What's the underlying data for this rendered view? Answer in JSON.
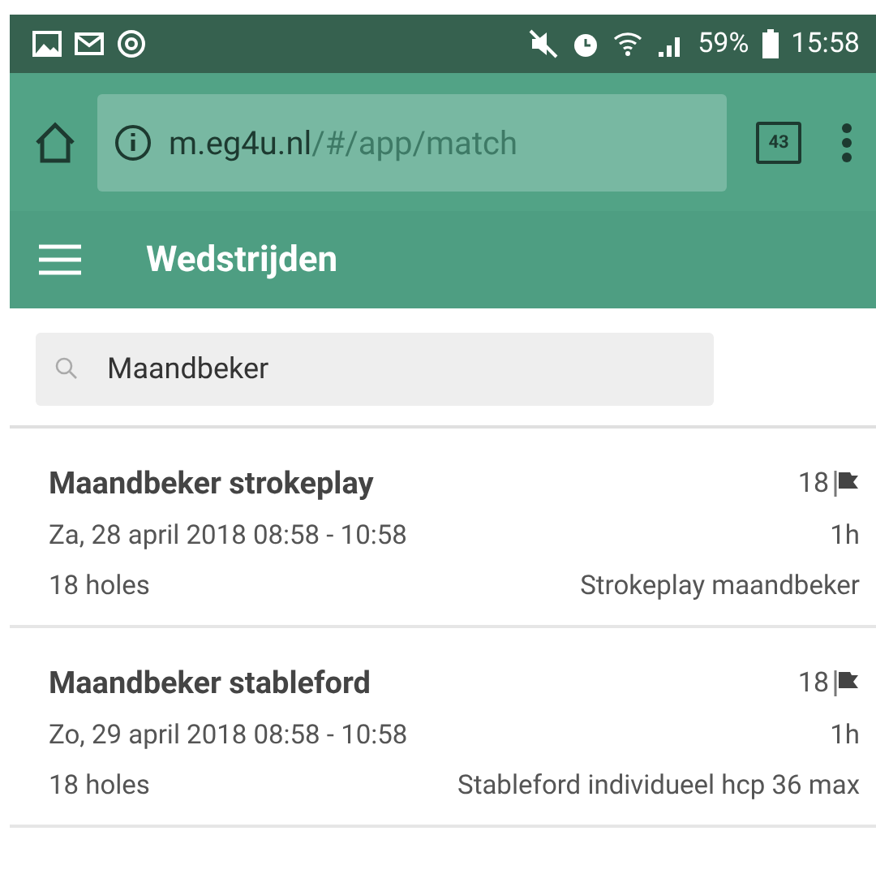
{
  "status_bar": {
    "battery": "59%",
    "time": "15:58"
  },
  "browser": {
    "url_host": "m.eg4u.nl",
    "url_path": "/#/app/match",
    "tab_count": "43"
  },
  "app_bar": {
    "title": "Wedstrijden"
  },
  "search": {
    "value": "Maandbeker"
  },
  "matches": [
    {
      "title": "Maandbeker strokeplay",
      "holes_count": "18",
      "date": "Za, 28 april 2018 08:58 - 10:58",
      "duration": "1h",
      "holes": "18 holes",
      "type": "Strokeplay maandbeker"
    },
    {
      "title": "Maandbeker stableford",
      "holes_count": "18",
      "date": "Zo, 29 april 2018 08:58 - 10:58",
      "duration": "1h",
      "holes": "18 holes",
      "type": "Stableford individueel hcp 36 max"
    }
  ]
}
